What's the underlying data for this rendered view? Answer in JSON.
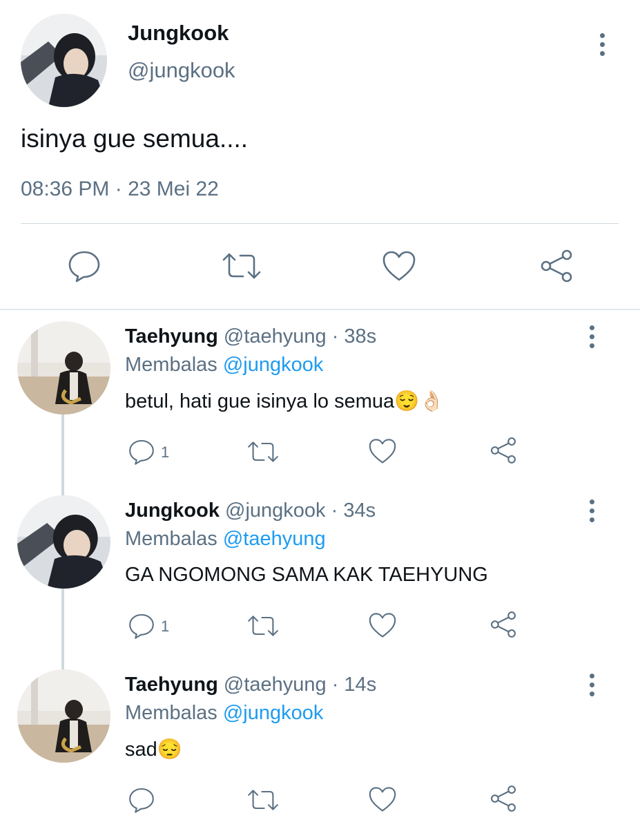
{
  "main_tweet": {
    "name": "Jungkook",
    "handle": "@jungkook",
    "text": "isinya gue semua....",
    "timestamp": "08:36 PM · 23 Mei 22",
    "actions": [
      "reply-icon",
      "retweet-icon",
      "like-icon",
      "share-icon"
    ]
  },
  "replies": [
    {
      "name": "Taehyung",
      "handle": "@taehyung",
      "time": "· 38s",
      "replying_label": "Membalas",
      "replying_to": "@jungkook",
      "text": "betul, hati gue isinya lo semua",
      "emoji": "😌👌🏻",
      "reply_count": "1"
    },
    {
      "name": "Jungkook",
      "handle": "@jungkook",
      "time": "· 34s",
      "replying_label": "Membalas",
      "replying_to": "@taehyung",
      "text": "GA NGOMONG SAMA KAK TAEHYUNG",
      "emoji": "",
      "reply_count": "1"
    },
    {
      "name": "Taehyung",
      "handle": "@taehyung",
      "time": "· 14s",
      "replying_label": "Membalas",
      "replying_to": "@jungkook",
      "text": "sad",
      "emoji": "😔",
      "reply_count": ""
    }
  ],
  "colors": {
    "text": "#0f1419",
    "muted": "#5b7083",
    "link": "#1d9bf0",
    "divider": "#cfd9de"
  }
}
